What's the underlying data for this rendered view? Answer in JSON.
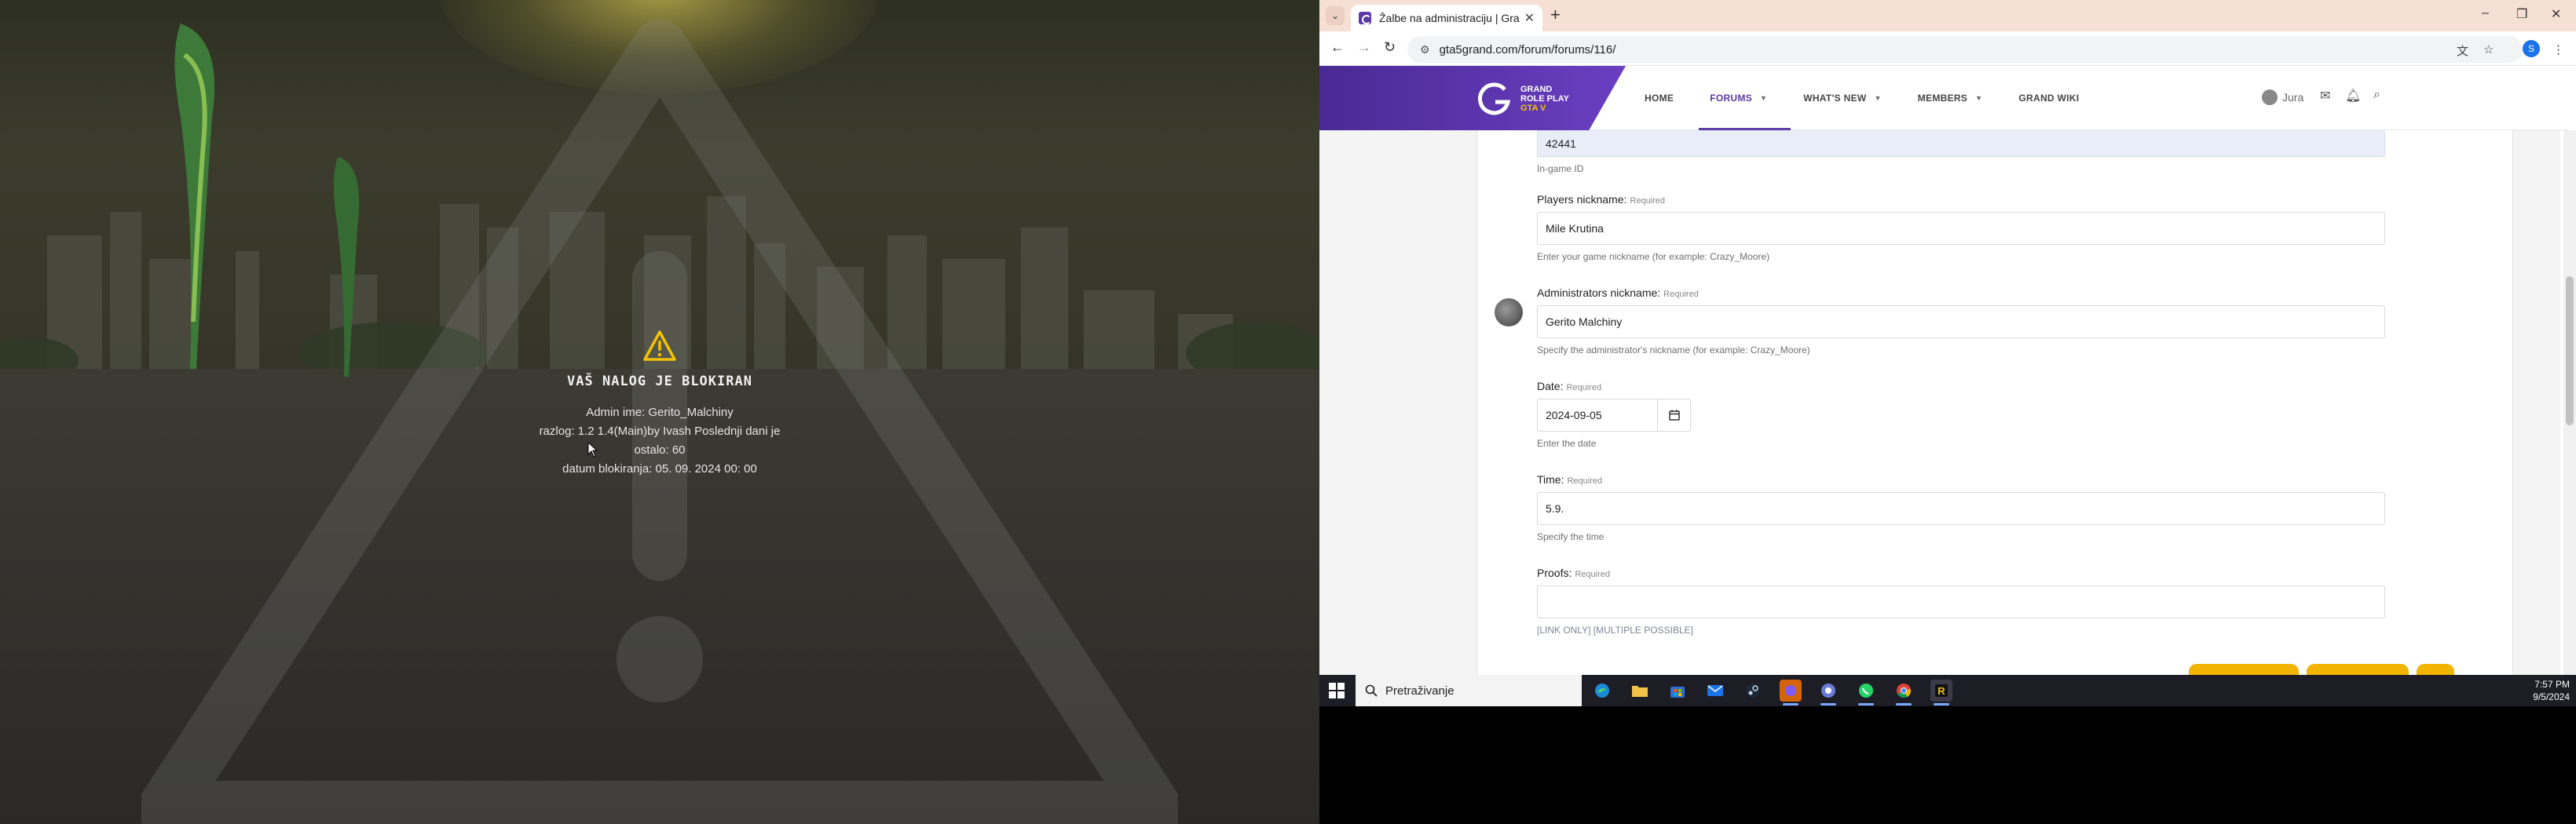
{
  "game": {
    "ban_title": "VAŠ NALOG JE BLOKIRAN",
    "lines": [
      "Admin ime: Gerito_Malchiny",
      "razlog: 1.2 1.4(Main)by Ivash Poslednji dani je",
      "ostalo: 60",
      "datum blokiranja: 05. 09. 2024 00: 00"
    ]
  },
  "browser": {
    "tab_title": "Žalbe na administraciju | Grand",
    "url": "gta5grand.com/forum/forums/116/",
    "profile_letter": "S"
  },
  "site": {
    "logo_lines": [
      "GRAND",
      "ROLE PLAY",
      "GTA V"
    ],
    "nav": [
      {
        "label": "HOME",
        "caret": false,
        "active": false
      },
      {
        "label": "FORUMS",
        "caret": true,
        "active": true
      },
      {
        "label": "WHAT'S NEW",
        "caret": true,
        "active": false
      },
      {
        "label": "MEMBERS",
        "caret": true,
        "active": false
      },
      {
        "label": "GRAND WIKI",
        "caret": false,
        "active": false
      }
    ],
    "username": "Jura"
  },
  "form": {
    "ingame_id": {
      "value": "42441",
      "hint": "In-game ID"
    },
    "players_nickname": {
      "label": "Players nickname:",
      "required": "Required",
      "value": "Mile Krutina",
      "hint": "Enter your game nickname (for example: Crazy_Moore)"
    },
    "admins_nickname": {
      "label": "Administrators nickname:",
      "required": "Required",
      "value": "Gerito Malchiny",
      "hint": "Specify the administrator's nickname (for example: Crazy_Moore)"
    },
    "date": {
      "label": "Date:",
      "required": "Required",
      "value": "2024-09-05",
      "hint": "Enter the date"
    },
    "time": {
      "label": "Time:",
      "required": "Required",
      "value": "5.9.",
      "hint": "Specify the time"
    },
    "proofs": {
      "label": "Proofs:",
      "required": "Required",
      "value": "",
      "hint": "[LINK ONLY] [MULTIPLE POSSIBLE]"
    }
  },
  "taskbar": {
    "search_placeholder": "Pretraživanje",
    "time": "7:57 PM",
    "date": "9/5/2024"
  },
  "colors": {
    "brand_purple": "#5b3aa6",
    "accent_yellow": "#f3b400",
    "tab_bar": "#f6dfd4"
  }
}
